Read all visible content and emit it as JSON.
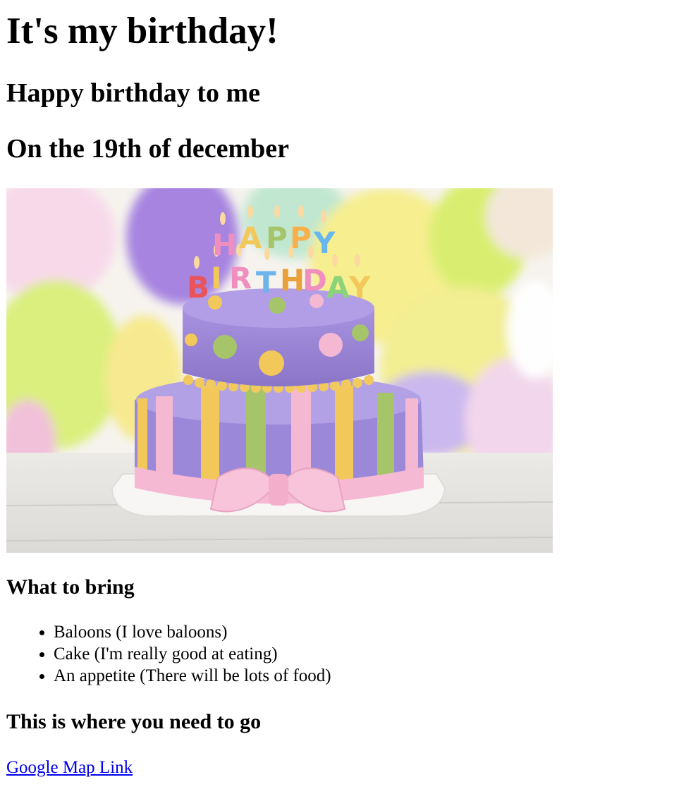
{
  "headings": {
    "title": "It's my birthday!",
    "subtitle": "Happy birthday to me",
    "date": "On the 19th of december"
  },
  "image": {
    "candle_letters": [
      "H",
      "A",
      "P",
      "P",
      "Y",
      "B",
      "I",
      "R",
      "T",
      "H",
      "D",
      "A",
      "Y"
    ]
  },
  "bring": {
    "heading": "What to bring",
    "items": [
      "Baloons (I love baloons)",
      "Cake (I'm really good at eating)",
      "An appetite (There will be lots of food)"
    ]
  },
  "location": {
    "heading": "This is where you need to go",
    "link_text": "Google Map Link"
  },
  "colors": {
    "link": "#0000ee",
    "cake_purple": "#9a86d6",
    "cake_pink": "#f4b8d2",
    "cake_yellow": "#f3c85a",
    "cake_green": "#a6c46a"
  }
}
